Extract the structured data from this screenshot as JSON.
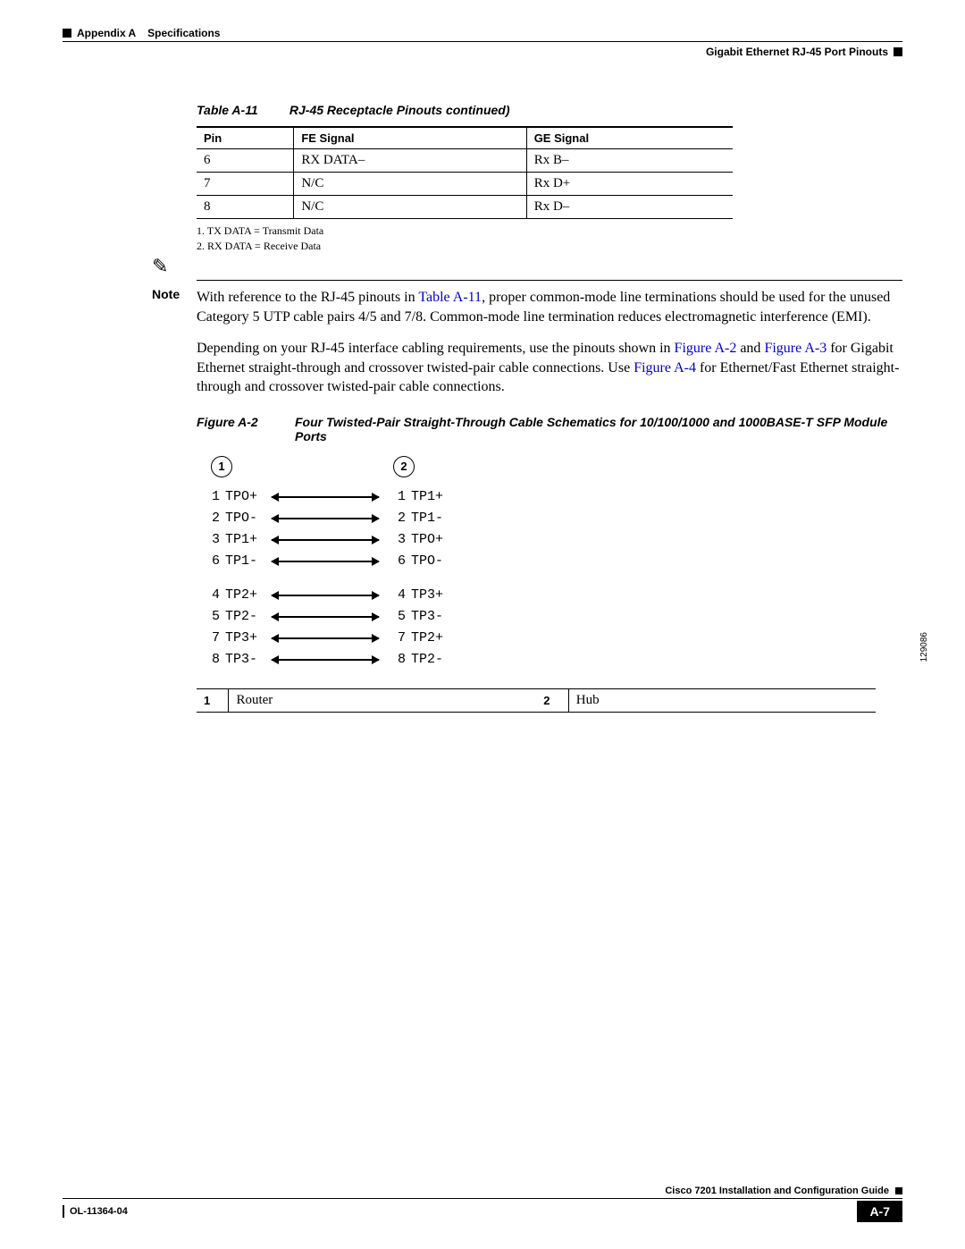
{
  "header": {
    "appendix": "Appendix A",
    "title": "Specifications",
    "section": "Gigabit Ethernet RJ-45 Port Pinouts"
  },
  "table": {
    "number": "Table A-11",
    "title": "RJ-45 Receptacle Pinouts continued)",
    "col1": "Pin",
    "col2": "FE Signal",
    "col3": "GE Signal",
    "rows": [
      {
        "pin": "6",
        "fe": "RX DATA–",
        "ge": "Rx B–"
      },
      {
        "pin": "7",
        "fe": "N/C",
        "ge": "Rx D+"
      },
      {
        "pin": "8",
        "fe": "N/C",
        "ge": "Rx D–"
      }
    ],
    "footnote1": "1.  TX DATA = Transmit Data",
    "footnote2": "2.  RX DATA = Receive Data"
  },
  "note": {
    "label": "Note",
    "pre": "With reference to the RJ-45 pinouts in ",
    "link": "Table A-11",
    "post": ", proper common-mode line terminations should be used for the unused Category 5 UTP cable pairs 4/5 and 7/8. Common-mode line termination reduces electromagnetic interference (EMI)."
  },
  "para": {
    "p1a": "Depending on your RJ-45 interface cabling requirements, use the pinouts shown in ",
    "linkA2": "Figure A-2",
    "p1b": " and ",
    "linkA3": "Figure A-3",
    "p1c": " for Gigabit Ethernet straight-through and crossover twisted-pair cable connections. Use ",
    "linkA4": "Figure A-4",
    "p1d": " for Ethernet/Fast Ethernet straight-through and crossover twisted-pair cable connections."
  },
  "figure": {
    "number": "Figure A-2",
    "title": "Four Twisted-Pair Straight-Through Cable Schematics for 10/100/1000 and 1000BASE-T SFP Module Ports",
    "head1": "1",
    "head2": "2",
    "group1": [
      {
        "lp": "1",
        "ll": "TPO+",
        "rp": "1",
        "rl": "TP1+"
      },
      {
        "lp": "2",
        "ll": "TPO-",
        "rp": "2",
        "rl": "TP1-"
      },
      {
        "lp": "3",
        "ll": "TP1+",
        "rp": "3",
        "rl": "TPO+"
      },
      {
        "lp": "6",
        "ll": "TP1-",
        "rp": "6",
        "rl": "TPO-"
      }
    ],
    "group2": [
      {
        "lp": "4",
        "ll": "TP2+",
        "rp": "4",
        "rl": "TP3+"
      },
      {
        "lp": "5",
        "ll": "TP2-",
        "rp": "5",
        "rl": "TP3-"
      },
      {
        "lp": "7",
        "ll": "TP3+",
        "rp": "7",
        "rl": "TP2+"
      },
      {
        "lp": "8",
        "ll": "TP3-",
        "rp": "8",
        "rl": "TP2-"
      }
    ],
    "artnum": "129086"
  },
  "legend": {
    "k1": "1",
    "v1": "Router",
    "k2": "2",
    "v2": "Hub"
  },
  "footer": {
    "guide": "Cisco 7201 Installation and Configuration Guide",
    "docnum": "OL-11364-04",
    "pagenum": "A-7"
  }
}
